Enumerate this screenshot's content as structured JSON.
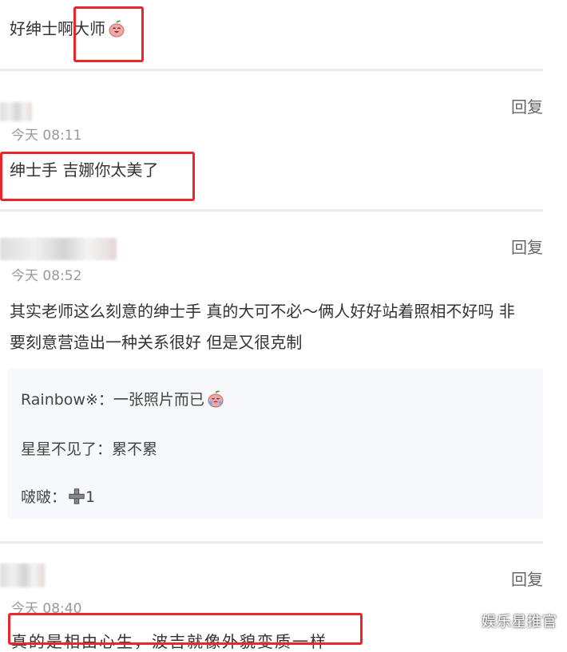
{
  "top_comment": {
    "text": "好绅士啊大师"
  },
  "comments": [
    {
      "time": "今天 08:11",
      "reply_label": "回复",
      "text": "绅士手 吉娜你太美了"
    },
    {
      "time": "今天 08:52",
      "reply_label": "回复",
      "text_line1": "其实老师这么刻意的绅士手 真的大可不必～俩人好好站着照相不好吗 非",
      "text_line2": "要刻意营造出一种关系很好 但是又很克制",
      "sub_replies": [
        {
          "user": "Rainbow※",
          "sep": "：",
          "text": "一张照片而已"
        },
        {
          "user": "星星不见了",
          "sep": "：",
          "text": "累不累"
        },
        {
          "user": "啵啵",
          "sep": "：",
          "text": "1"
        }
      ]
    },
    {
      "time": "今天 08:40",
      "reply_label": "回复",
      "text": "真的是相由心生，波吉就像外貌变质一样"
    }
  ],
  "watermark": "娱乐星推官",
  "colors": {
    "highlight_box": "#e8262c",
    "divider": "#e9ecef",
    "sub_reply_bg": "#f6f8fb"
  }
}
